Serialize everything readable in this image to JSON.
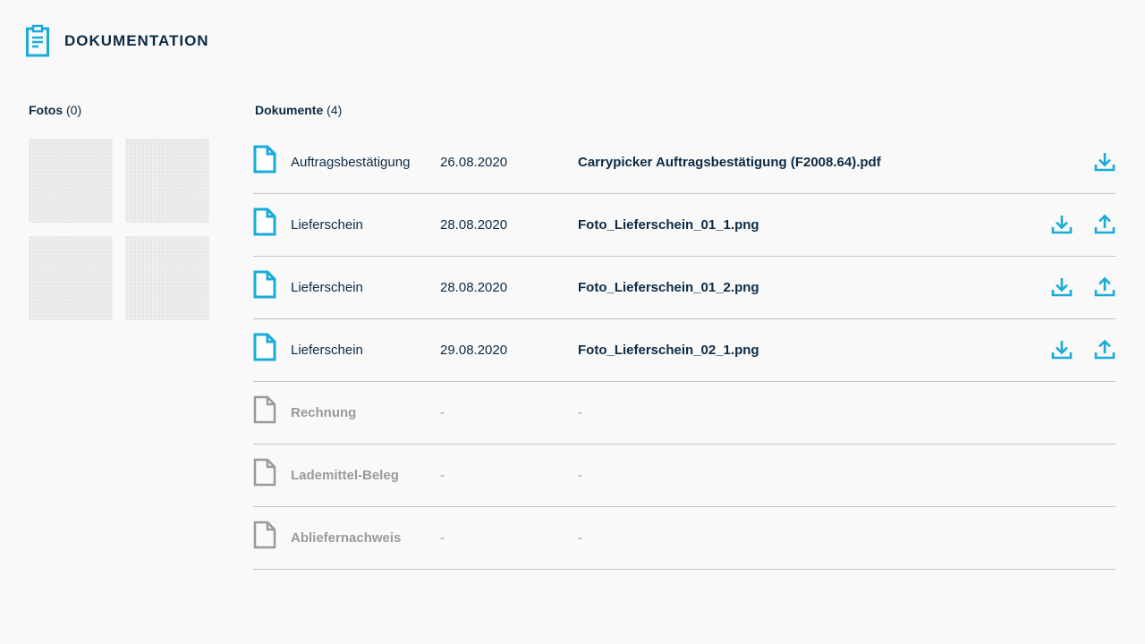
{
  "header": {
    "title": "DOKUMENTATION",
    "icon": "clipboard-icon"
  },
  "fotos": {
    "label": "Fotos",
    "count": "(0)",
    "thumbnails": 4
  },
  "dokumente": {
    "label": "Dokumente",
    "count": "(4)",
    "rows": [
      {
        "type": "Auftragsbestätigung",
        "date": "26.08.2020",
        "file": "Carrypicker Auftragsbestätigung (F2008.64).pdf",
        "available": true,
        "download": true,
        "upload": false
      },
      {
        "type": "Lieferschein",
        "date": "28.08.2020",
        "file": "Foto_Lieferschein_01_1.png",
        "available": true,
        "download": true,
        "upload": true
      },
      {
        "type": "Lieferschein",
        "date": "28.08.2020",
        "file": "Foto_Lieferschein_01_2.png",
        "available": true,
        "download": true,
        "upload": true
      },
      {
        "type": "Lieferschein",
        "date": "29.08.2020",
        "file": "Foto_Lieferschein_02_1.png",
        "available": true,
        "download": true,
        "upload": true
      },
      {
        "type": "Rechnung",
        "date": "-",
        "file": "-",
        "available": false,
        "download": false,
        "upload": false
      },
      {
        "type": "Lademittel-Beleg",
        "date": "-",
        "file": "-",
        "available": false,
        "download": false,
        "upload": false
      },
      {
        "type": "Abliefernachweis",
        "date": "-",
        "file": "-",
        "available": false,
        "download": false,
        "upload": false
      }
    ]
  },
  "colors": {
    "accent": "#1aabd9",
    "text": "#0d2b45",
    "muted": "#9a9a9a",
    "divider": "#b9c6d2",
    "background": "#f9f9f9"
  },
  "icons": {
    "document_available": "document-icon",
    "document_missing": "document-outline-icon",
    "download": "download-icon",
    "upload": "upload-icon"
  }
}
